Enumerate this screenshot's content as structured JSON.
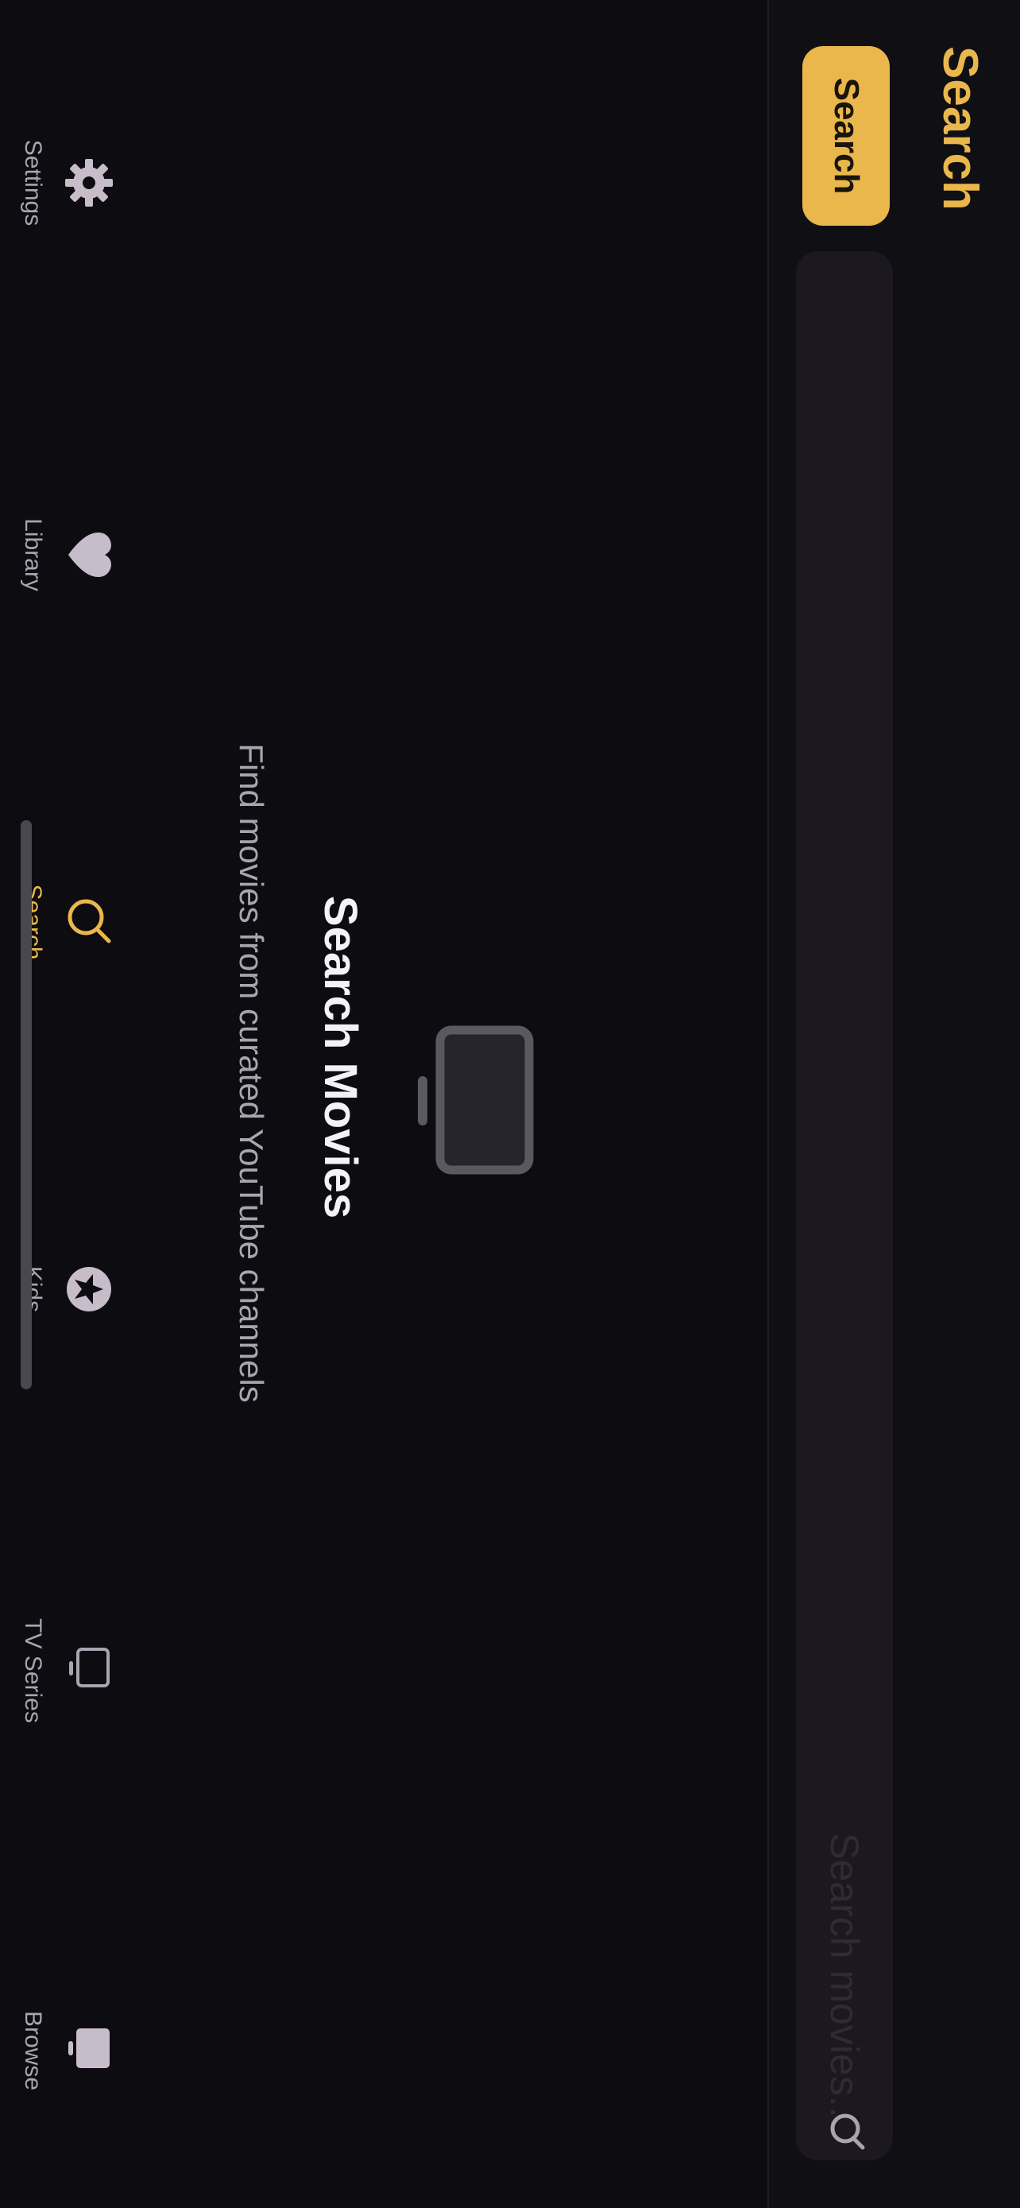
{
  "page": {
    "title": "Search"
  },
  "search": {
    "placeholder": "Search movies...",
    "value": "",
    "button_label": "Search"
  },
  "empty_state": {
    "title": "Search Movies",
    "subtitle": "Find movies from curated YouTube channels",
    "icon": "tv-icon"
  },
  "tabs": [
    {
      "label": "Browse",
      "icon": "browse-tv-icon",
      "active": false
    },
    {
      "label": "TV Series",
      "icon": "tv-series-icon",
      "active": false
    },
    {
      "label": "Kids",
      "icon": "kids-star-icon",
      "active": false
    },
    {
      "label": "Search",
      "icon": "search-icon",
      "active": true
    },
    {
      "label": "Library",
      "icon": "heart-icon",
      "active": false
    },
    {
      "label": "Settings",
      "icon": "gear-icon",
      "active": false
    }
  ],
  "colors": {
    "accent": "#e9b74b",
    "background": "#0d0c10",
    "inactive": "#a9a5b0"
  }
}
